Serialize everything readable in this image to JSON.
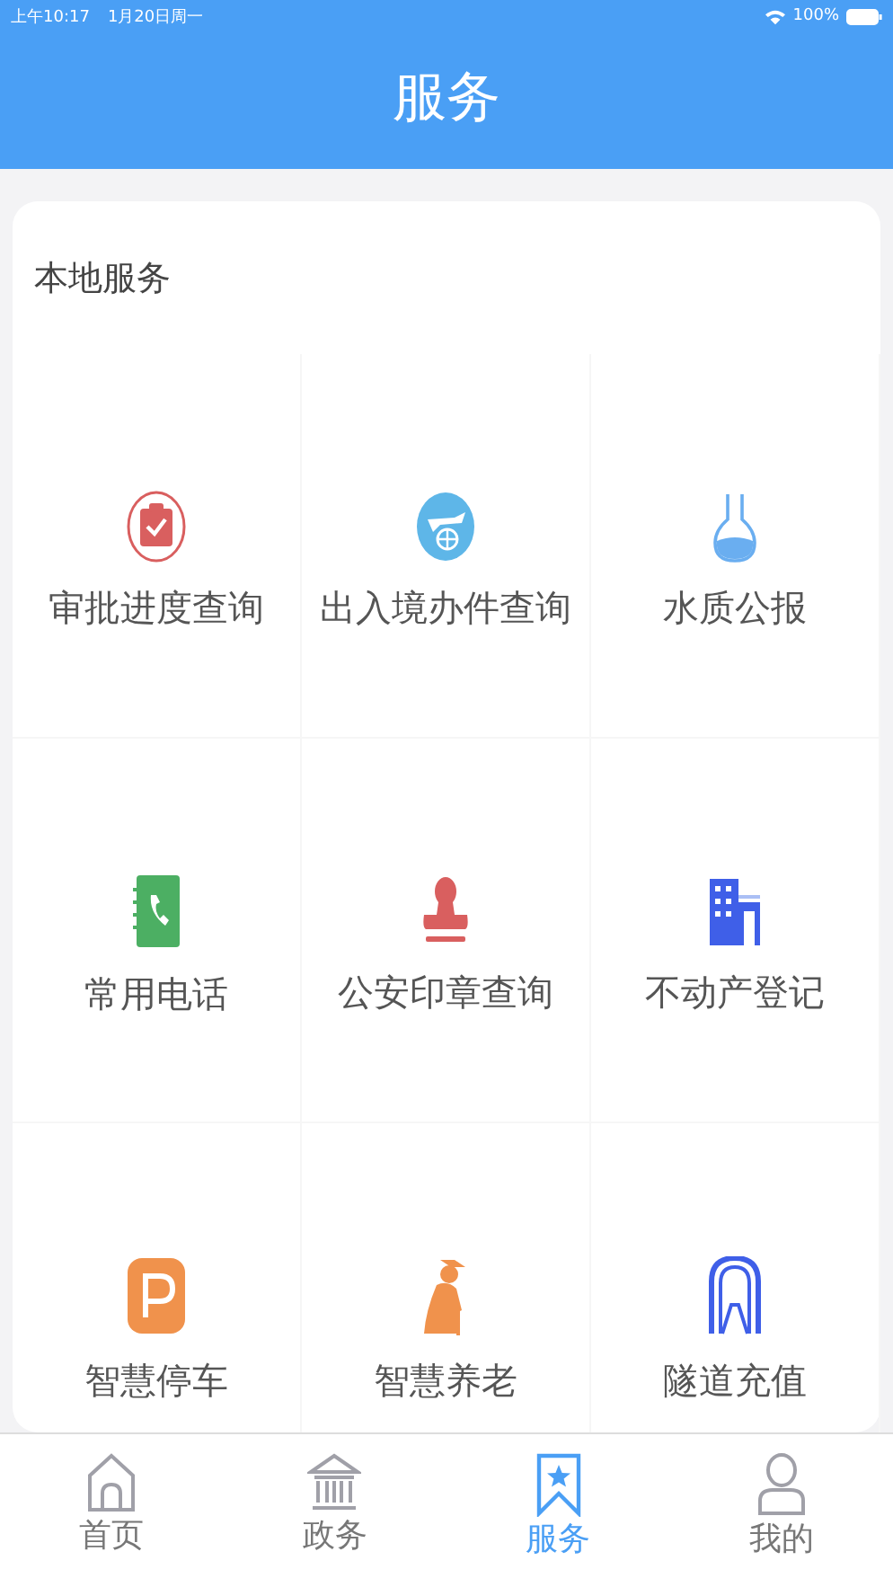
{
  "status_bar": {
    "time": "上午10:17",
    "date": "1月20日周一",
    "battery": "100%"
  },
  "header": {
    "title": "服务"
  },
  "section": {
    "title": "本地服务",
    "items": [
      {
        "label": "审批进度查询"
      },
      {
        "label": "出入境办件查询"
      },
      {
        "label": "水质公报"
      },
      {
        "label": "常用电话"
      },
      {
        "label": "公安印章查询"
      },
      {
        "label": "不动产登记"
      },
      {
        "label": "智慧停车"
      },
      {
        "label": "智慧养老"
      },
      {
        "label": "隧道充值"
      }
    ]
  },
  "tab_bar": [
    {
      "label": "首页",
      "selected": false
    },
    {
      "label": "政务",
      "selected": false
    },
    {
      "label": "服务",
      "selected": true
    },
    {
      "label": "我的",
      "selected": false
    }
  ]
}
